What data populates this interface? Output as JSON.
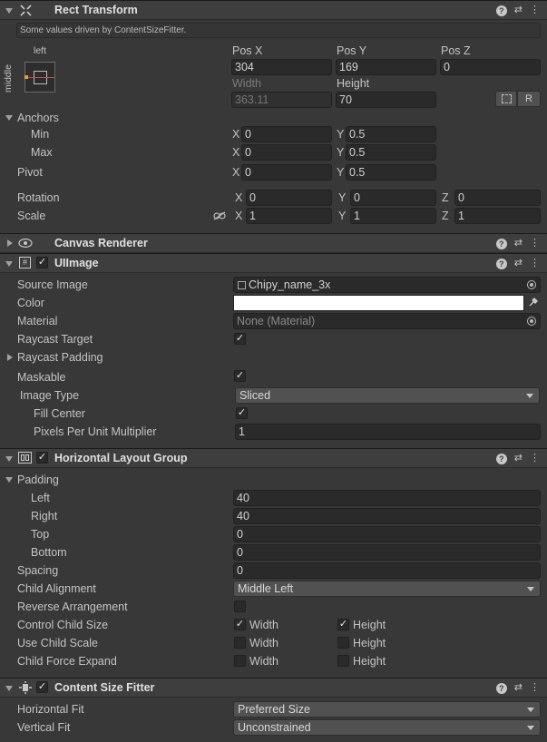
{
  "rect_transform": {
    "title": "Rect Transform",
    "notice": "Some values driven by ContentSizeFitter.",
    "anchor_h": "left",
    "anchor_v": "middle",
    "pos_x_label": "Pos X",
    "pos_y_label": "Pos Y",
    "pos_z_label": "Pos Z",
    "pos_x": "304",
    "pos_y": "169",
    "pos_z": "0",
    "width_label": "Width",
    "height_label": "Height",
    "width": "363.11",
    "height": "70",
    "r_label": "R",
    "anchors_label": "Anchors",
    "min_label": "Min",
    "max_label": "Max",
    "pivot_label": "Pivot",
    "x_axis": "X",
    "y_axis": "Y",
    "z_axis": "Z",
    "anchor_min_x": "0",
    "anchor_min_y": "0.5",
    "anchor_max_x": "0",
    "anchor_max_y": "0.5",
    "pivot_x": "0",
    "pivot_y": "0.5",
    "rotation_label": "Rotation",
    "rot_x": "0",
    "rot_y": "0",
    "rot_z": "0",
    "scale_label": "Scale",
    "scale_x": "1",
    "scale_y": "1",
    "scale_z": "1"
  },
  "canvas_renderer": {
    "title": "Canvas Renderer"
  },
  "ui_image": {
    "title": "UIImage",
    "source_image_label": "Source Image",
    "source_image": "Chipy_name_3x",
    "color_label": "Color",
    "color_value": "#ffffff",
    "material_label": "Material",
    "material": "None (Material)",
    "raycast_target_label": "Raycast Target",
    "raycast_padding_label": "Raycast Padding",
    "maskable_label": "Maskable",
    "image_type_label": "Image Type",
    "image_type": "Sliced",
    "fill_center_label": "Fill Center",
    "ppu_label": "Pixels Per Unit Multiplier",
    "ppu": "1"
  },
  "hlg": {
    "title": "Horizontal Layout Group",
    "padding_label": "Padding",
    "left_label": "Left",
    "left": "40",
    "right_label": "Right",
    "right": "40",
    "top_label": "Top",
    "top": "0",
    "bottom_label": "Bottom",
    "bottom": "0",
    "spacing_label": "Spacing",
    "spacing": "0",
    "child_alignment_label": "Child Alignment",
    "child_alignment": "Middle Left",
    "reverse_label": "Reverse Arrangement",
    "control_child_size_label": "Control Child Size",
    "use_child_scale_label": "Use Child Scale",
    "child_force_expand_label": "Child Force Expand",
    "width_label": "Width",
    "height_label": "Height"
  },
  "csf": {
    "title": "Content Size Fitter",
    "horizontal_fit_label": "Horizontal Fit",
    "horizontal_fit": "Preferred Size",
    "vertical_fit_label": "Vertical Fit",
    "vertical_fit": "Unconstrained"
  },
  "check_mark": "✓"
}
